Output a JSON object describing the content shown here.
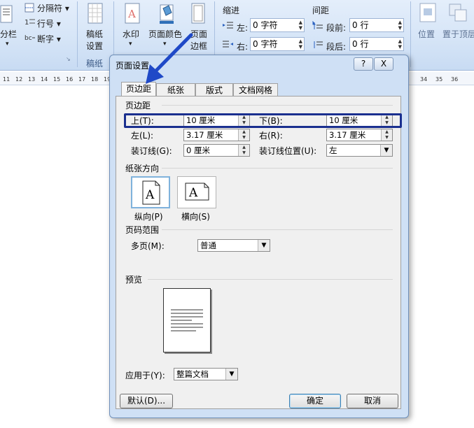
{
  "ribbon": {
    "columns_label": "分栏",
    "breaks_label": "分隔符",
    "line_numbers_label": "行号",
    "hyphenation_label": "断字",
    "draft_label_1": "稿纸",
    "draft_label_2": "设置",
    "draft_group_label": "稿纸",
    "watermark_label": "水印",
    "page_color_label": "页面颜色",
    "page_border_label_1": "页面",
    "page_border_label_2": "边框",
    "indent_title": "缩进",
    "indent_left_label": "左:",
    "indent_left_value": "0 字符",
    "indent_right_label": "右:",
    "indent_right_value": "0 字符",
    "spacing_title": "间距",
    "spacing_before_label": "段前:",
    "spacing_before_value": "0 行",
    "spacing_after_label": "段后:",
    "spacing_after_value": "0 行",
    "position_label": "位置",
    "bring_front_label": "置于顶层"
  },
  "ruler": {
    "left_ticks": [
      "11",
      "12",
      "13",
      "14",
      "15",
      "16",
      "17",
      "18",
      "19",
      "20"
    ],
    "right_ticks": [
      "34",
      "35",
      "36"
    ]
  },
  "dialog": {
    "title": "页面设置",
    "help_label": "?",
    "close_label": "X",
    "tabs": [
      "页边距",
      "纸张",
      "版式",
      "文档网格"
    ],
    "margins_section": "页边距",
    "top_label": "上(T):",
    "top_value": "10 厘米",
    "bottom_label": "下(B):",
    "bottom_value": "10 厘米",
    "left_label": "左(L):",
    "left_value": "3.17 厘米",
    "right_label": "右(R):",
    "right_value": "3.17 厘米",
    "gutter_label": "装订线(G):",
    "gutter_value": "0 厘米",
    "gutter_pos_label": "装订线位置(U):",
    "gutter_pos_value": "左",
    "orientation_section": "纸张方向",
    "portrait_label": "纵向(P)",
    "landscape_label": "横向(S)",
    "pages_section": "页码范围",
    "multiple_pages_label": "多页(M):",
    "multiple_pages_value": "普通",
    "preview_section": "预览",
    "apply_to_label": "应用于(Y):",
    "apply_to_value": "整篇文档",
    "default_button": "默认(D)...",
    "ok_button": "确定",
    "cancel_button": "取消",
    "orientation_glyph": "A"
  },
  "colors": {
    "highlight": "#1a2f8f",
    "arrow": "#1f49c7",
    "ribbon_bg": "#d6e5f7"
  }
}
